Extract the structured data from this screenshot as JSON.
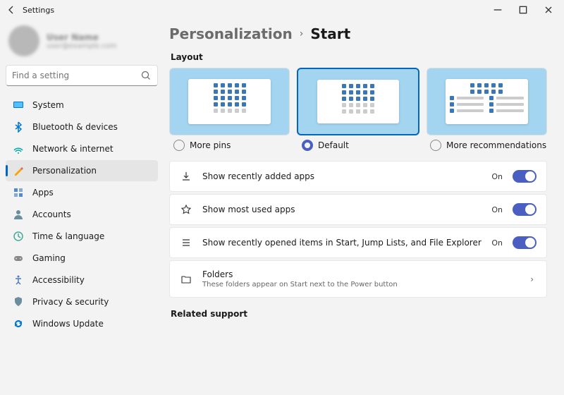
{
  "window": {
    "title": "Settings"
  },
  "profile": {
    "name": "User Name",
    "email": "user@example.com"
  },
  "search": {
    "placeholder": "Find a setting"
  },
  "sidebar": {
    "items": [
      {
        "label": "System"
      },
      {
        "label": "Bluetooth & devices"
      },
      {
        "label": "Network & internet"
      },
      {
        "label": "Personalization"
      },
      {
        "label": "Apps"
      },
      {
        "label": "Accounts"
      },
      {
        "label": "Time & language"
      },
      {
        "label": "Gaming"
      },
      {
        "label": "Accessibility"
      },
      {
        "label": "Privacy & security"
      },
      {
        "label": "Windows Update"
      }
    ]
  },
  "breadcrumb": {
    "parent": "Personalization",
    "current": "Start"
  },
  "sections": {
    "layout": "Layout",
    "related": "Related support"
  },
  "layout": {
    "options": [
      {
        "label": "More pins",
        "selected": false
      },
      {
        "label": "Default",
        "selected": true
      },
      {
        "label": "More recommendations",
        "selected": false
      }
    ]
  },
  "settings": [
    {
      "label": "Show recently added apps",
      "state": "On"
    },
    {
      "label": "Show most used apps",
      "state": "On"
    },
    {
      "label": "Show recently opened items in Start, Jump Lists, and File Explorer",
      "state": "On"
    }
  ],
  "folders": {
    "label": "Folders",
    "sub": "These folders appear on Start next to the Power button"
  }
}
